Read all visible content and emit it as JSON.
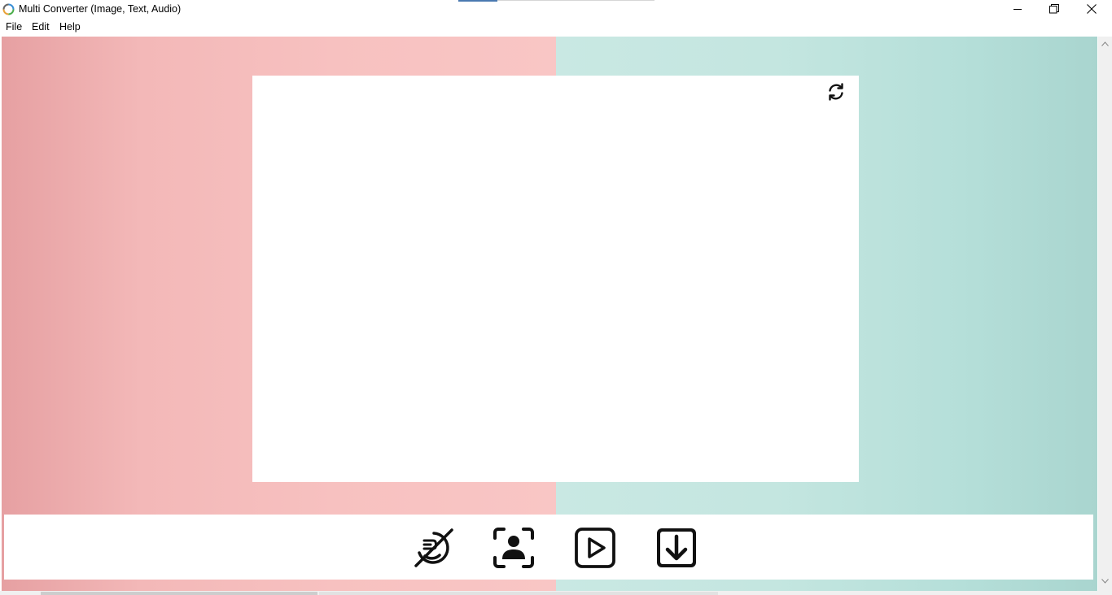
{
  "window": {
    "title": "Multi Converter (Image, Text, Audio)",
    "app_icon": "converter-app-icon",
    "controls": [
      "minimize-icon",
      "maximize-icon",
      "close-icon"
    ]
  },
  "menu": {
    "items": [
      {
        "label": "File"
      },
      {
        "label": "Edit"
      },
      {
        "label": "Help"
      }
    ]
  },
  "preview": {
    "refresh_icon": "refresh-icon"
  },
  "toolbar": {
    "buttons": [
      {
        "icon": "text-recognition-off-icon"
      },
      {
        "icon": "person-scan-icon"
      },
      {
        "icon": "play-icon"
      },
      {
        "icon": "download-icon"
      }
    ]
  },
  "colors": {
    "left_bg": "#f5bcbc",
    "right_bg": "#bfe5df",
    "icon_color": "#111111"
  }
}
